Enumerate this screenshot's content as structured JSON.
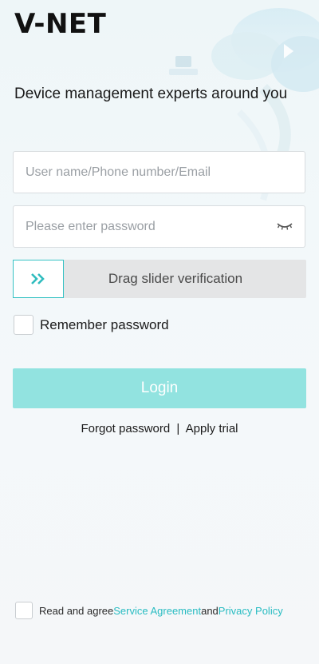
{
  "app": {
    "logo_text": "V-NET",
    "tagline": "Device management experts around you"
  },
  "form": {
    "username_placeholder": "User name/Phone number/Email",
    "password_placeholder": "Please enter password",
    "slider_label": "Drag slider verification",
    "remember_label": "Remember password",
    "login_label": "Login"
  },
  "links": {
    "forgot": "Forgot password",
    "separator": "|",
    "apply_trial": "Apply trial"
  },
  "agreement": {
    "prefix": "Read and agree",
    "service": "Service Agreement",
    "conjunction": "and",
    "privacy": "Privacy Policy"
  },
  "colors": {
    "accent": "#36c2c4",
    "login_button": "#92e3e0",
    "link": "#29bcc2"
  },
  "icons": {
    "password_toggle": "eye-closed-icon",
    "slider_handle": "double-chevron-right-icon"
  }
}
